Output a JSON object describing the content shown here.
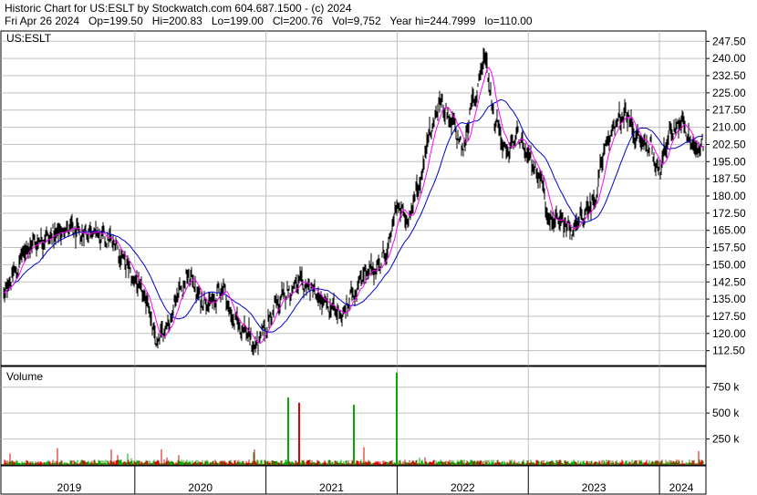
{
  "header": {
    "line1": "Historic Chart for US:ESLT by Stockwatch.com 604.687.1500 - (c) 2024",
    "line2": "Fri Apr 26 2024   Op=199.50   Hi=200.83   Lo=199.00   Cl=200.76   Vol=9,752   Year hi=244.7999   lo=110.00"
  },
  "colors": {
    "price_bar": "#000000",
    "ma_short": "#ff00ff",
    "ma_long": "#0000cc",
    "volume_up": "#00aa00",
    "volume_down": "#dd0000",
    "grid": "#c0c0c0",
    "frame": "#000000"
  },
  "chart_data": [
    {
      "type": "candlestick-bar",
      "panel": "price",
      "label": "US:ESLT",
      "x_ticks": [
        "2019",
        "2020",
        "2021",
        "2022",
        "2023",
        "2024"
      ],
      "y_ticks": [
        "247.50",
        "240.00",
        "232.50",
        "225.00",
        "217.50",
        "210.00",
        "202.50",
        "195.00",
        "187.50",
        "180.00",
        "172.50",
        "165.00",
        "157.50",
        "150.00",
        "142.50",
        "135.00",
        "127.50",
        "120.00",
        "112.50"
      ],
      "ylim": [
        106.0,
        252.0
      ],
      "series": [
        {
          "values": [
            {
              "date": "2019-01",
              "close": 138
            },
            {
              "date": "2019-02",
              "close": 146
            },
            {
              "date": "2019-03",
              "close": 157
            },
            {
              "date": "2019-04",
              "close": 160
            },
            {
              "date": "2019-05",
              "close": 162
            },
            {
              "date": "2019-06",
              "close": 164
            },
            {
              "date": "2019-07",
              "close": 166
            },
            {
              "date": "2019-08",
              "close": 163
            },
            {
              "date": "2019-09",
              "close": 165
            },
            {
              "date": "2019-10",
              "close": 162
            },
            {
              "date": "2019-11",
              "close": 160
            },
            {
              "date": "2019-12",
              "close": 152
            },
            {
              "date": "2020-01",
              "close": 143
            },
            {
              "date": "2020-02",
              "close": 135
            },
            {
              "date": "2020-03",
              "close": 116
            },
            {
              "date": "2020-04",
              "close": 124
            },
            {
              "date": "2020-05",
              "close": 138
            },
            {
              "date": "2020-06",
              "close": 145
            },
            {
              "date": "2020-07",
              "close": 135
            },
            {
              "date": "2020-08",
              "close": 133
            },
            {
              "date": "2020-09",
              "close": 140
            },
            {
              "date": "2020-10",
              "close": 126
            },
            {
              "date": "2020-11",
              "close": 122
            },
            {
              "date": "2020-12",
              "close": 114
            },
            {
              "date": "2021-01",
              "close": 123
            },
            {
              "date": "2021-02",
              "close": 133
            },
            {
              "date": "2021-03",
              "close": 138
            },
            {
              "date": "2021-04",
              "close": 142
            },
            {
              "date": "2021-05",
              "close": 140
            },
            {
              "date": "2021-06",
              "close": 134
            },
            {
              "date": "2021-07",
              "close": 131
            },
            {
              "date": "2021-08",
              "close": 128
            },
            {
              "date": "2021-09",
              "close": 138
            },
            {
              "date": "2021-10",
              "close": 146
            },
            {
              "date": "2021-11",
              "close": 148
            },
            {
              "date": "2021-12",
              "close": 155
            },
            {
              "date": "2022-01",
              "close": 175
            },
            {
              "date": "2022-02",
              "close": 170
            },
            {
              "date": "2022-03",
              "close": 185
            },
            {
              "date": "2022-04",
              "close": 208
            },
            {
              "date": "2022-05",
              "close": 221
            },
            {
              "date": "2022-06",
              "close": 212
            },
            {
              "date": "2022-07",
              "close": 201
            },
            {
              "date": "2022-08",
              "close": 222
            },
            {
              "date": "2022-09",
              "close": 240
            },
            {
              "date": "2022-10",
              "close": 213
            },
            {
              "date": "2022-11",
              "close": 199
            },
            {
              "date": "2022-12",
              "close": 206
            },
            {
              "date": "2023-01",
              "close": 197
            },
            {
              "date": "2023-02",
              "close": 189
            },
            {
              "date": "2023-03",
              "close": 170
            },
            {
              "date": "2023-04",
              "close": 168
            },
            {
              "date": "2023-05",
              "close": 165
            },
            {
              "date": "2023-06",
              "close": 171
            },
            {
              "date": "2023-07",
              "close": 178
            },
            {
              "date": "2023-08",
              "close": 200
            },
            {
              "date": "2023-09",
              "close": 212
            },
            {
              "date": "2023-10",
              "close": 215
            },
            {
              "date": "2023-11",
              "close": 205
            },
            {
              "date": "2023-12",
              "close": 202
            },
            {
              "date": "2024-01",
              "close": 192
            },
            {
              "date": "2024-02",
              "close": 208
            },
            {
              "date": "2024-03",
              "close": 212
            },
            {
              "date": "2024-04",
              "close": 202
            }
          ]
        }
      ],
      "grid": true
    },
    {
      "type": "bar",
      "panel": "volume",
      "label": "Volume",
      "y_ticks": [
        "750 k",
        "500 k",
        "250 k"
      ],
      "ylim": [
        0,
        950
      ],
      "spikes": [
        {
          "date": "2021-03",
          "value": 650,
          "direction": "up"
        },
        {
          "date": "2021-04",
          "value": 600,
          "direction": "down"
        },
        {
          "date": "2021-09",
          "value": 580,
          "direction": "up"
        },
        {
          "date": "2022-01",
          "value": 890,
          "direction": "up"
        }
      ],
      "typical_value": 30,
      "grid": true
    }
  ]
}
